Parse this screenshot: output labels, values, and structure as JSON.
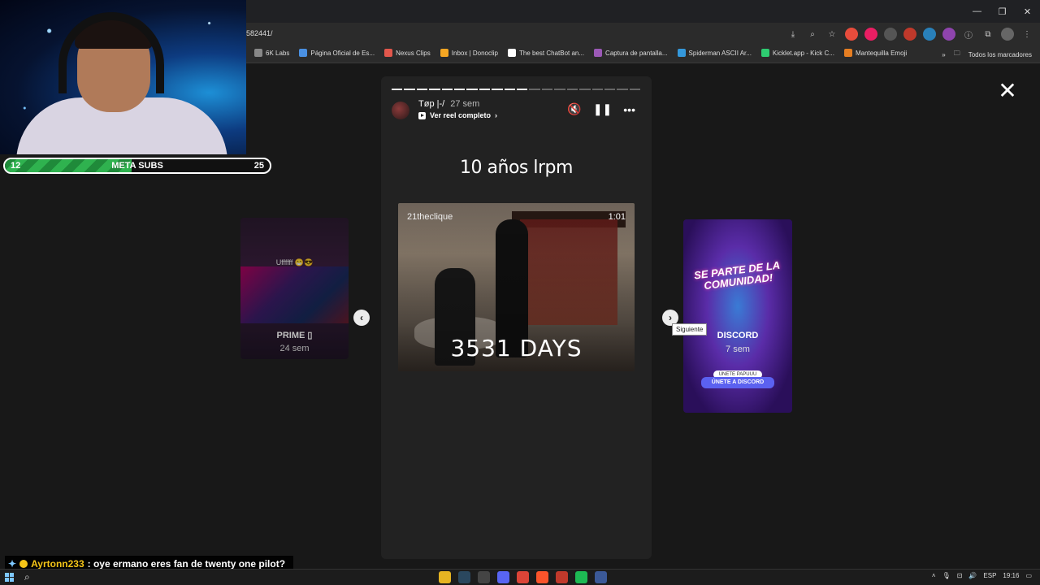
{
  "browser": {
    "url": "582441/",
    "bookmarks": [
      {
        "label": "6K Labs",
        "color": "#888888"
      },
      {
        "label": "Página Oficial de Es...",
        "color": "#4a90e2"
      },
      {
        "label": "Nexus Clips",
        "color": "#e2574c"
      },
      {
        "label": "Inbox | Donoclip",
        "color": "#f5a623"
      },
      {
        "label": "The best ChatBot an...",
        "color": "#ffffff"
      },
      {
        "label": "Captura de pantalla...",
        "color": "#9b59b6"
      },
      {
        "label": "Spiderman ASCII Ar...",
        "color": "#3498db"
      },
      {
        "label": "Kicklet.app - Kick C...",
        "color": "#2ecc71"
      },
      {
        "label": "Mantequilla Emoji",
        "color": "#e67e22"
      }
    ],
    "more_bookmarks": "»",
    "all_bookmarks": "Todos los marcadores"
  },
  "overlay": {
    "meta_left": "12",
    "meta_label": "META SUBS",
    "meta_right": "25",
    "meta_progress": 0.48
  },
  "story": {
    "username": "Tøp |-/",
    "age": "27 sem",
    "reel_link": "Ver reel completo",
    "title": "10 años lrpm",
    "video_creator": "21theclique",
    "video_duration": "1:01",
    "video_text": "3531 DAYS",
    "close": "✕",
    "mute_icon": "🔇",
    "pause_icon": "❚❚",
    "more_icon": "•••"
  },
  "prev_story": {
    "caption": "Uffffff 😁😎",
    "name": "PRIME ▯",
    "age": "24 sem"
  },
  "next_story": {
    "promo": "SE PARTE DE LA COMUNIDAD!",
    "name": "DISCORD",
    "age": "7 sem",
    "btn_small": "ÚNETE PAPUUU",
    "btn_discord": "ÚNETE A DISCORD"
  },
  "nav": {
    "prev": "‹",
    "next": "›",
    "tooltip": "Siguiente"
  },
  "chat": {
    "user": "Ayrtonn233",
    "message": ": oye ermano eres fan de twenty one pilot?"
  },
  "taskbar": {
    "lang": "ESP",
    "time": "19:16"
  }
}
